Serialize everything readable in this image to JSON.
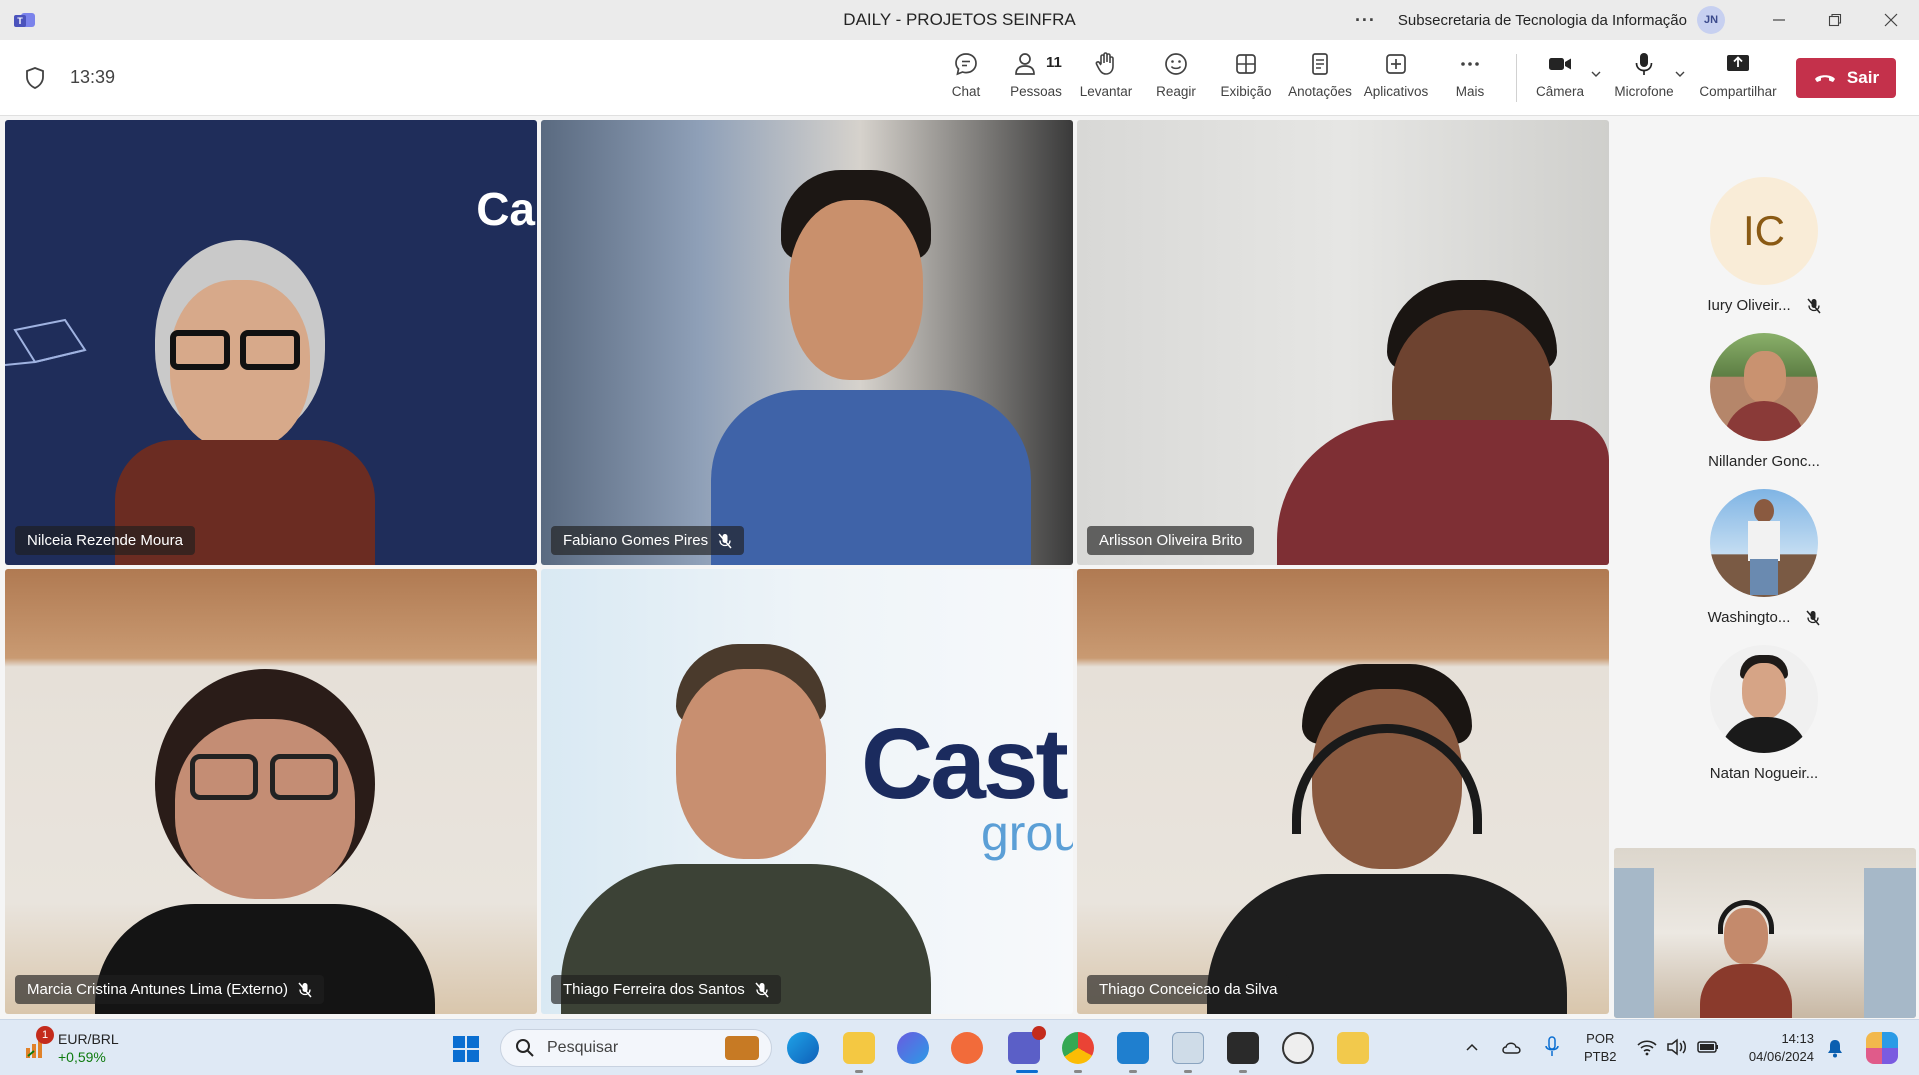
{
  "window": {
    "title": "DAILY - PROJETOS SEINFRA",
    "more_dots": "···",
    "org": "Subsecretaria de Tecnologia da Informação",
    "user_initials": "JN"
  },
  "toolbar": {
    "timer": "13:39",
    "chat": "Chat",
    "people": "Pessoas",
    "people_count": "11",
    "raise": "Levantar",
    "react": "Reagir",
    "view": "Exibição",
    "notes": "Anotações",
    "apps": "Aplicativos",
    "more": "Mais",
    "camera": "Câmera",
    "mic": "Microfone",
    "share": "Compartilhar",
    "leave": "Sair"
  },
  "tiles": [
    {
      "name": "Nilceia Rezende Moura",
      "muted": false
    },
    {
      "name": "Fabiano Gomes Pires",
      "muted": true
    },
    {
      "name": "Arlisson Oliveira Brito",
      "muted": false
    },
    {
      "name": "Marcia Cristina Antunes Lima (Externo)",
      "muted": true
    },
    {
      "name": "Thiago Ferreira dos Santos",
      "muted": true
    },
    {
      "name": "Thiago Conceicao da Silva",
      "muted": false
    }
  ],
  "backgrounds": {
    "cast_logo_1": "Ca",
    "cast_logo_2": "Cast",
    "cast_group": "grou"
  },
  "sidebar": [
    {
      "initials": "IC",
      "name": "Iury Oliveir...",
      "muted": true
    },
    {
      "name": "Nillander Gonc...",
      "muted": false
    },
    {
      "name": "Washingto...",
      "muted": true
    },
    {
      "name": "Natan Nogueir...",
      "muted": false
    }
  ],
  "taskbar": {
    "weather_badge": "1",
    "ticker": "EUR/BRL",
    "ticker_change": "+0,59%",
    "search_placeholder": "Pesquisar",
    "lang_1": "POR",
    "lang_2": "PTB2",
    "time": "14:13",
    "date": "04/06/2024"
  },
  "colors": {
    "leave": "#c4314b",
    "accent": "#5b5fc7"
  }
}
